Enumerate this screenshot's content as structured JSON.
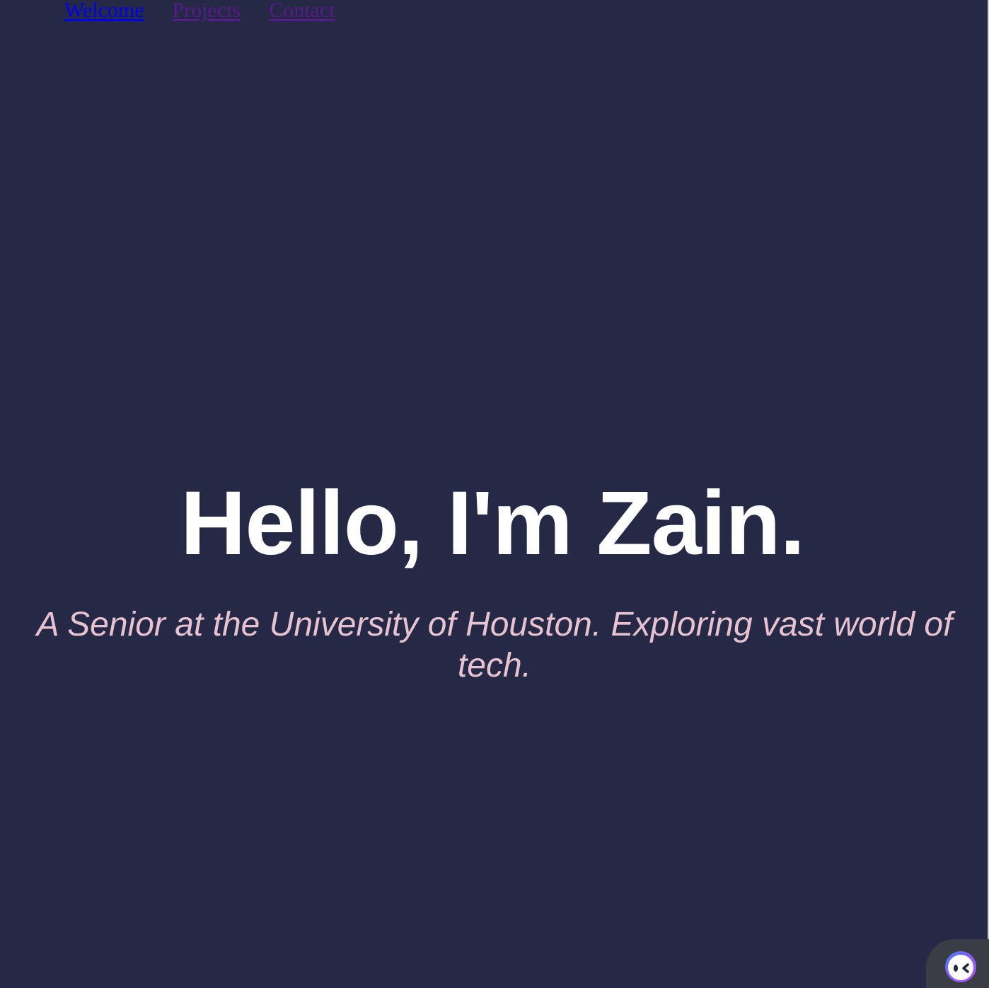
{
  "nav": {
    "items": [
      {
        "label": "Welcome",
        "state": "active"
      },
      {
        "label": "Projects",
        "state": "visited"
      },
      {
        "label": "Contact",
        "state": "visited"
      }
    ]
  },
  "hero": {
    "title": "Hello, I'm Zain.",
    "subtitle": "A Senior at the University of Houston. Exploring vast world of tech."
  },
  "widget": {
    "icon": "chat-bot-face-icon"
  },
  "colors": {
    "background": "#252945",
    "title": "#ffffff",
    "subtitle": "#e7c2d0",
    "link_active": "#0000ee",
    "link_visited": "#551a8b"
  }
}
